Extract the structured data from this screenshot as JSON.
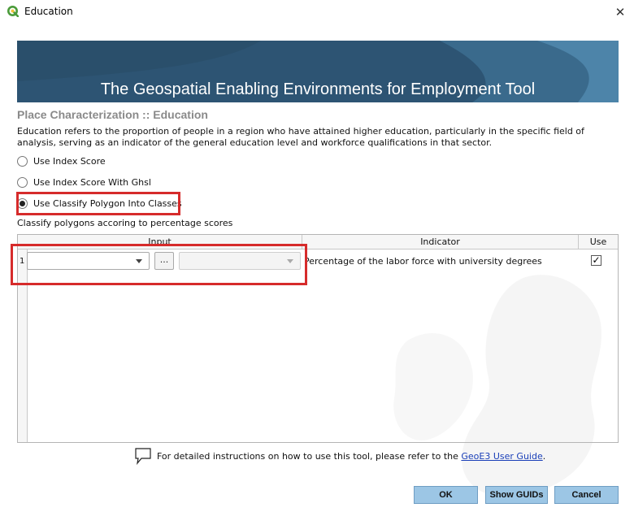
{
  "window": {
    "title": "Education",
    "icon": "qgis-icon",
    "close_icon": "close-icon"
  },
  "banner": {
    "title": "The Geospatial Enabling Environments for Employment Tool"
  },
  "page": {
    "heading": "Place Characterization :: Education",
    "description": "Education refers to the proportion of people in a region who have attained higher education, particularly in the specific field of analysis, serving as an indicator of the general education level and workforce qualifications in that sector."
  },
  "options": [
    {
      "label": "Use Index Score",
      "selected": false
    },
    {
      "label": "Use Index Score With Ghsl",
      "selected": false
    },
    {
      "label": "Use Classify Polygon Into Classes",
      "selected": true
    }
  ],
  "classify_label": "Classify polygons accoring to percentage scores",
  "table": {
    "headers": [
      "Input",
      "Indicator",
      "Use"
    ],
    "rows": [
      {
        "row_number": "1",
        "layer_value": "",
        "browse_label": "...",
        "field_value": "",
        "indicator": "Percentage of the labor force with university degrees",
        "use": true
      }
    ]
  },
  "help": {
    "icon": "speech-bubble-icon",
    "text": "For detailed instructions on how to use this tool, please refer to the",
    "link_text": "GeoE3 User Guide",
    "suffix": "."
  },
  "buttons": {
    "ok": "OK",
    "show_guids": "Show GUIDs",
    "cancel": "Cancel"
  },
  "colors": {
    "banner": "#2e5572",
    "highlight": "#d62b2b",
    "button": "#9cc6e5",
    "heading": "#8a8a8a"
  }
}
